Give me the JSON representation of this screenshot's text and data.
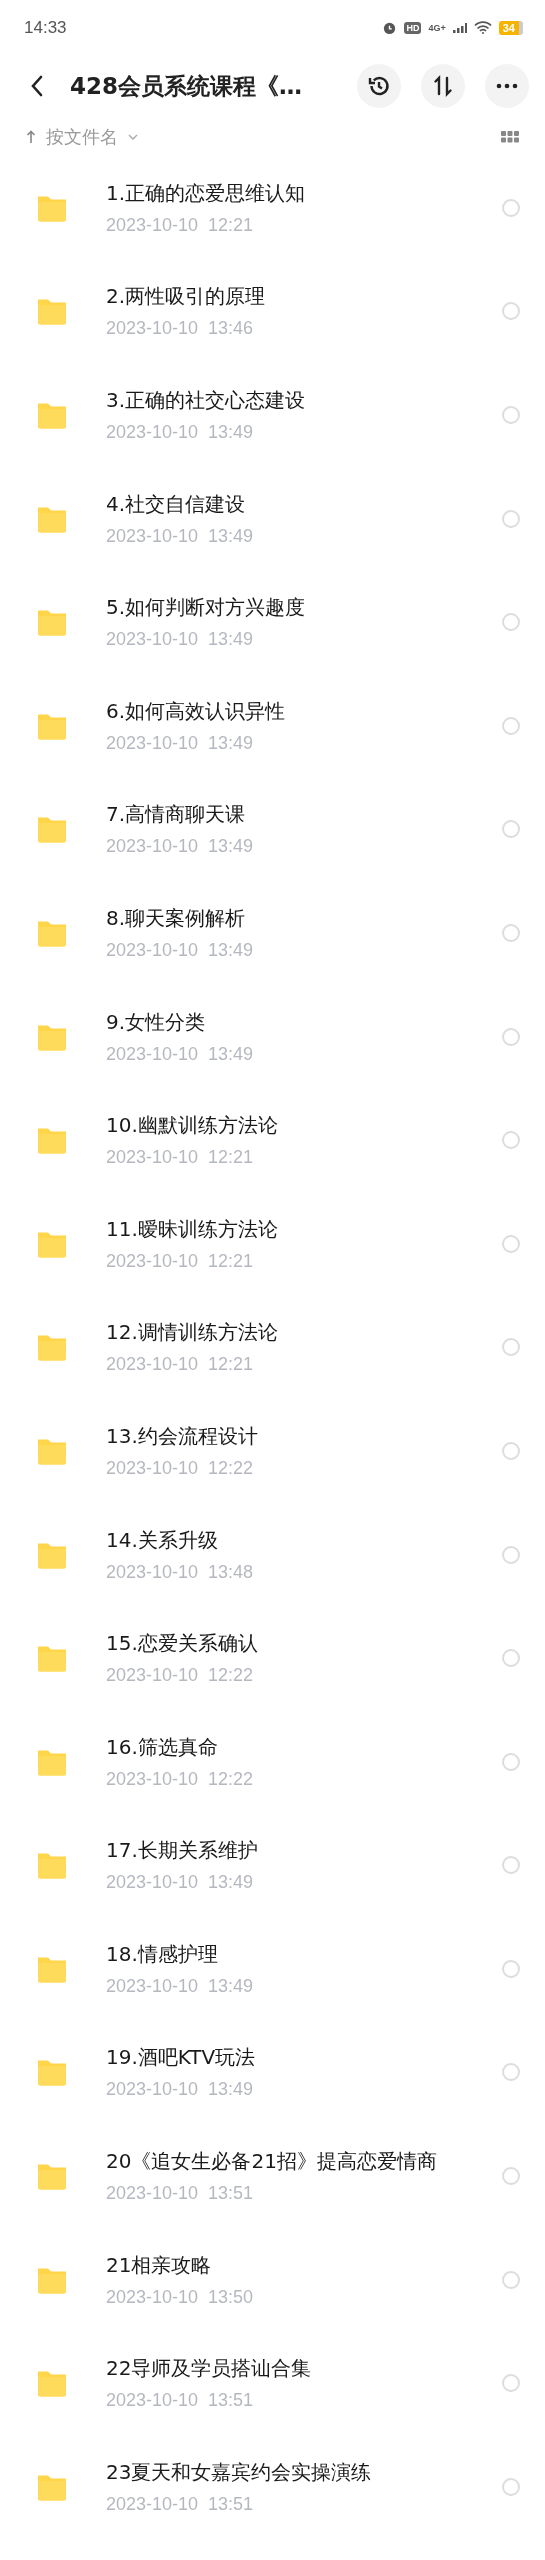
{
  "status_bar": {
    "time": "14:33",
    "hd": "HD",
    "network": "4G+",
    "battery": "34"
  },
  "header": {
    "title": "428会员系统课程《…"
  },
  "sort_bar": {
    "label": "按文件名"
  },
  "files": [
    {
      "name": "1.正确的恋爱思维认知",
      "date": "2023-10-10  12:21",
      "selected": false
    },
    {
      "name": "2.两性吸引的原理",
      "date": "2023-10-10  13:46",
      "selected": false
    },
    {
      "name": "3.正确的社交心态建设",
      "date": "2023-10-10  13:49",
      "selected": false
    },
    {
      "name": "4.社交自信建设",
      "date": "2023-10-10  13:49",
      "selected": false
    },
    {
      "name": "5.如何判断对方兴趣度",
      "date": "2023-10-10  13:49",
      "selected": false
    },
    {
      "name": "6.如何高效认识异性",
      "date": "2023-10-10  13:49",
      "selected": false
    },
    {
      "name": "7.高情商聊天课",
      "date": "2023-10-10  13:49",
      "selected": false
    },
    {
      "name": "8.聊天案例解析",
      "date": "2023-10-10  13:49",
      "selected": false
    },
    {
      "name": "9.女性分类",
      "date": "2023-10-10  13:49",
      "selected": false
    },
    {
      "name": "10.幽默训练方法论",
      "date": "2023-10-10  12:21",
      "selected": false
    },
    {
      "name": "11.暧昧训练方法论",
      "date": "2023-10-10  12:21",
      "selected": false
    },
    {
      "name": "12.调情训练方法论",
      "date": "2023-10-10  12:21",
      "selected": false
    },
    {
      "name": "13.约会流程设计",
      "date": "2023-10-10  12:22",
      "selected": false
    },
    {
      "name": "14.关系升级",
      "date": "2023-10-10  13:48",
      "selected": false
    },
    {
      "name": "15.恋爱关系确认",
      "date": "2023-10-10  12:22",
      "selected": false
    },
    {
      "name": "16.筛选真命",
      "date": "2023-10-10  12:22",
      "selected": false
    },
    {
      "name": "17.长期关系维护",
      "date": "2023-10-10  13:49",
      "selected": false
    },
    {
      "name": "18.情感护理",
      "date": "2023-10-10  13:49",
      "selected": false
    },
    {
      "name": "19.酒吧KTV玩法",
      "date": "2023-10-10  13:49",
      "selected": false
    },
    {
      "name": "20《追女生必备21招》提高恋爱情商",
      "date": "2023-10-10  13:51",
      "selected": false
    },
    {
      "name": "21相亲攻略",
      "date": "2023-10-10  13:50",
      "selected": false
    },
    {
      "name": "22导师及学员搭讪合集",
      "date": "2023-10-10  13:51",
      "selected": false
    },
    {
      "name": "23夏天和女嘉宾约会实操演练",
      "date": "2023-10-10  13:51",
      "selected": false
    }
  ]
}
